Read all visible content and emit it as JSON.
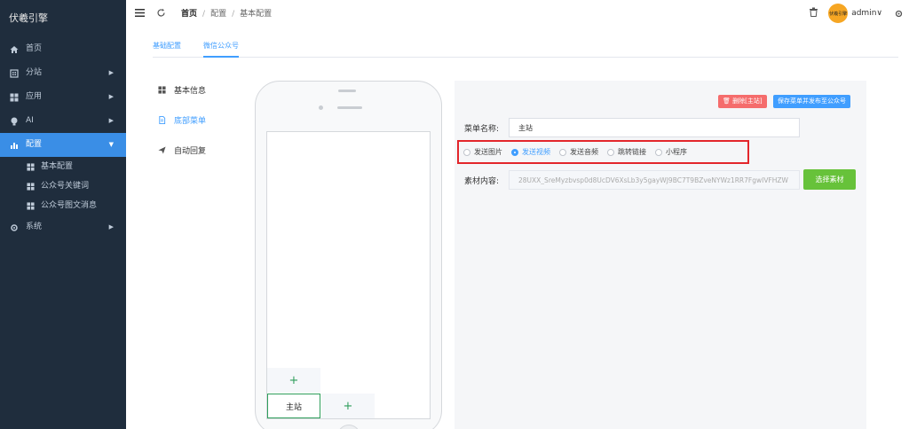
{
  "brand": "伏羲引擎",
  "sidebar": {
    "items": [
      {
        "label": "首页",
        "icon": "home-icon"
      },
      {
        "label": "分站",
        "icon": "building-icon"
      },
      {
        "label": "应用",
        "icon": "grid-icon"
      },
      {
        "label": "AI",
        "icon": "bulb-icon"
      },
      {
        "label": "配置",
        "icon": "chart-icon"
      },
      {
        "label": "系统",
        "icon": "gear-icon"
      }
    ],
    "sub_items": [
      {
        "label": "基本配置"
      },
      {
        "label": "公众号关键词"
      },
      {
        "label": "公众号图文消息"
      }
    ],
    "active_color": "#3a8ee6",
    "bg_color": "#1f2d3d"
  },
  "header": {
    "breadcrumb": [
      "首页",
      "配置",
      "基本配置"
    ],
    "user": "admin",
    "avatar_text": "伏羲引擎",
    "dropdown_glyph": "∨"
  },
  "tabs": [
    {
      "label": "基础配置",
      "active": false
    },
    {
      "label": "微信公众号",
      "active": true
    }
  ],
  "left_menu": [
    {
      "label": "基本信息",
      "icon": "grid-icon",
      "active": false
    },
    {
      "label": "底部菜单",
      "icon": "document-icon",
      "active": true
    },
    {
      "label": "自动回复",
      "icon": "send-icon",
      "active": false
    }
  ],
  "phone": {
    "menu_main_label": "主站",
    "add_glyph": "+"
  },
  "panel": {
    "delete_button": "删除[主站]",
    "save_button": "保存菜单并发布至公众号",
    "name_label": "菜单名称:",
    "name_value": "主站",
    "radio_options": [
      "发送图片",
      "发送视频",
      "发送音频",
      "跳转链接",
      "小程序"
    ],
    "radio_selected": "发送视频",
    "material_label": "素材内容:",
    "material_value": "28UXX_SreMyzbvsp0d8UcDV6XsLb3y5gayWJ9BC7T9BZveNYWz1RR7FgwIVFHZW",
    "pick_button": "选择素材"
  },
  "colors": {
    "primary": "#409eff",
    "danger": "#f56c6c",
    "success": "#67c23a",
    "highlight_border": "#e3262b"
  }
}
